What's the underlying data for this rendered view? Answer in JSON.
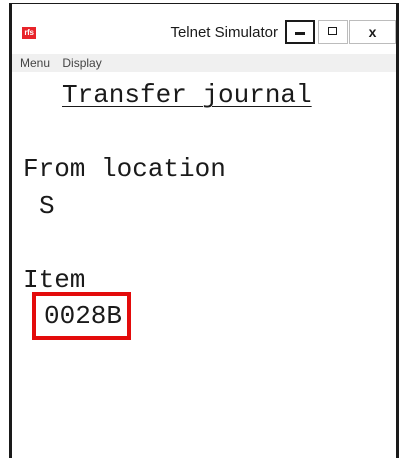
{
  "window": {
    "title": "Telnet Simulator",
    "app_icon_text": "rfs",
    "controls": {
      "minimize": "minimize",
      "maximize": "maximize",
      "close": "x"
    }
  },
  "menu": {
    "items": [
      "Menu",
      "Display"
    ]
  },
  "screen": {
    "heading": "Transfer journal",
    "from_location_label": "From location",
    "from_location_value": "S",
    "item_label": "Item",
    "item_value": "0028B"
  },
  "colors": {
    "highlight_border": "#e30b0b",
    "app_icon": "#e8242a"
  }
}
